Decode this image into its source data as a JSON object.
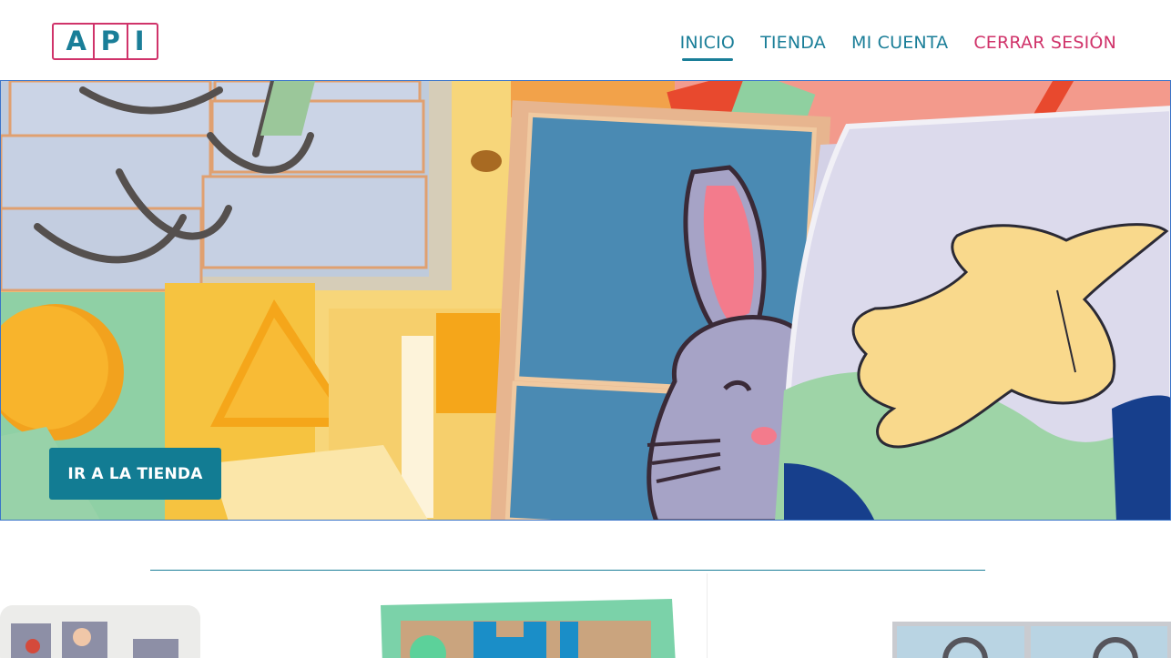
{
  "header": {
    "logo": {
      "letters": [
        "A",
        "P",
        "I"
      ]
    },
    "nav": [
      {
        "label": "INICIO",
        "active": true
      },
      {
        "label": "TIENDA",
        "active": false
      },
      {
        "label": "MI CUENTA",
        "active": false
      },
      {
        "label": "CERRAR SESIÓN",
        "active": false
      }
    ]
  },
  "hero": {
    "cta_label": "IR A LA TIENDA",
    "image": "wooden-educational-toys-photo"
  },
  "colors": {
    "brand_teal": "#1a7e98",
    "brand_pink": "#d0336a",
    "cta_background": "#127c93"
  },
  "products": [
    {
      "image": "memory-game-cards"
    },
    {
      "image": "shape-sorting-puzzle"
    },
    {
      "image": "picture-puzzle-blocks"
    }
  ]
}
